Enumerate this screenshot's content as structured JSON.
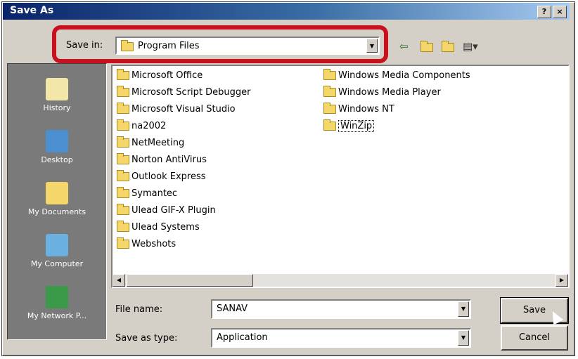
{
  "window": {
    "title": "Save As",
    "help_label": "?",
    "close_label": "×"
  },
  "save_in": {
    "label": "Save in:",
    "value": "Program Files"
  },
  "toolbar": {
    "back_icon": "back-arrow-icon",
    "up_icon": "up-folder-icon",
    "new_folder_icon": "new-folder-icon",
    "views_icon": "view-menu-icon"
  },
  "places": [
    {
      "label": "History",
      "icon": "history-icon"
    },
    {
      "label": "Desktop",
      "icon": "desktop-icon"
    },
    {
      "label": "My Documents",
      "icon": "my-documents-icon"
    },
    {
      "label": "My Computer",
      "icon": "my-computer-icon"
    },
    {
      "label": "My Network P...",
      "icon": "network-places-icon"
    }
  ],
  "files_col1": [
    "Microsoft Office",
    "Microsoft Script Debugger",
    "Microsoft Visual Studio",
    "na2002",
    "NetMeeting",
    "Norton AntiVirus",
    "Outlook Express",
    "Symantec",
    "Ulead GIF-X Plugin",
    "Ulead Systems",
    "Webshots"
  ],
  "files_col2": [
    "Windows Media Components",
    "Windows Media Player",
    "Windows NT",
    "WinZip"
  ],
  "selected_file": "WinZip",
  "file_name": {
    "label": "File name:",
    "value": "SANAV"
  },
  "save_as_type": {
    "label": "Save as type:",
    "value": "Application"
  },
  "buttons": {
    "save": "Save",
    "cancel": "Cancel"
  },
  "colors": {
    "highlight": "#c8101e",
    "titlebar": "#0a246a",
    "face": "#d4d0c8"
  }
}
